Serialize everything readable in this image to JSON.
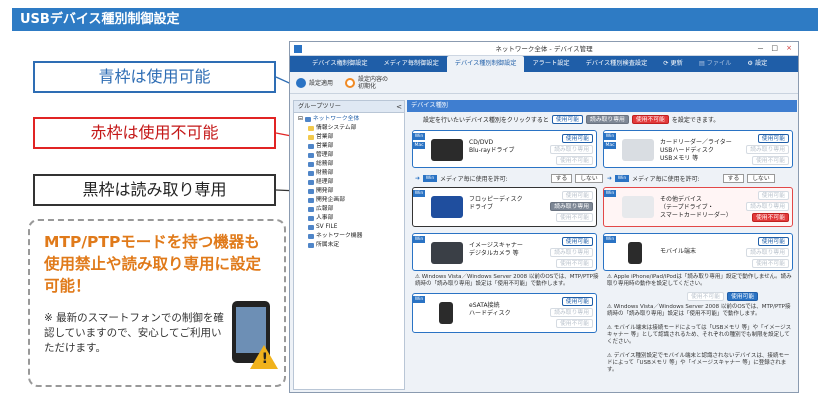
{
  "page_title": "USBデバイス種別制御設定",
  "callouts": {
    "blue": "青枠は使用可能",
    "red": "赤枠は使用不可能",
    "black": "黒枠は読み取り専用"
  },
  "note": {
    "main": "MTP/PTPモードを持つ機器も使用禁止や読み取り専用に設定可能！",
    "sub": "※ 最新のスマートフォンでの制御を確認していますので、安心してご利用いただけます。"
  },
  "app": {
    "window_title": "ネットワーク全体 - デバイス管理",
    "window_buttons": [
      "－",
      "□",
      "×"
    ],
    "tabs": [
      "デバイス権制御設定",
      "メディア毎制御設定",
      "デバイス種別制御設定",
      "アラート設定",
      "デバイス種別検査設定",
      "更新",
      "ファイル",
      "設定"
    ],
    "toolbar": {
      "apply": "設定適用",
      "restore": "設定内容の\n初期化"
    },
    "sidebar": {
      "title": "グループツリー",
      "collapse": "<",
      "items": [
        "ネットワーク全体",
        "情報システム部",
        "営業部",
        "営業部",
        "管理部",
        "総務部",
        "財務部",
        "経理部",
        "開発部",
        "開発企画部",
        "広報部",
        "人事部",
        "SV FILE",
        "ネットワーク機器",
        "所属未定"
      ]
    },
    "main": {
      "heading": "デバイス種別",
      "instruction_pre": "設定を行いたいデバイス種別をクリックすると",
      "instruction_post": "を設定できます。",
      "pill_usable": "使用可能",
      "pill_readonly": "読み取り専用",
      "pill_unusable": "使用不可能",
      "os_win": "Win",
      "os_mac": "Mac",
      "cards": [
        {
          "label": "CD/DVD\nBlu-rayドライブ",
          "state": "blue",
          "b1": "使用可能",
          "b2": "読み取り専用",
          "b3": "使用不可能"
        },
        {
          "label": "カードリーダー／ライター\nUSBハードディスク\nUSBメモリ 等",
          "state": "blue",
          "b1": "使用可能",
          "b2": "読み取り専用",
          "b3": "使用不可能"
        },
        {
          "label": "フロッピーディスク\nドライブ",
          "state": "black",
          "b1": "使用可能",
          "b2": "読み取り専用",
          "b3": "使用不可能"
        },
        {
          "label": "その他デバイス\n（テープドライブ・\nスマートカードリーダー）",
          "state": "red",
          "b1": "使用可能",
          "b2": "読み取り専用",
          "b3": "使用不可能"
        },
        {
          "label": "イメージスキャナー\nデジタルカメラ 等",
          "state": "blue",
          "b1": "使用可能",
          "b2": "読み取り専用",
          "b3": "使用不可能"
        },
        {
          "label": "モバイル端末",
          "state": "blue",
          "b1": "使用可能",
          "b2": "読み取り専用",
          "b3": "使用不可能"
        },
        {
          "label": "eSATA接続\nハードディスク",
          "state": "blue",
          "b1": "使用可能",
          "b2": "読み取り専用",
          "b3": "使用不可能"
        }
      ],
      "media_strip": "メディア毎に使用を許可:",
      "strip_do": "する",
      "strip_dont": "しない",
      "notes": [
        "Windows Vista／Windows Server 2008 以前のOSでは、MTP/PTP接続時の「読み取り専用」設定は「使用不可能」で動作します。",
        "Apple iPhone/iPad/iPodは「読み取り専用」設定で動作しません。読み取り専用時の動作を設定してください。",
        "Windows Vista／Windows Server 2008 以前のOSでは、MTP/PTP接続時の「読み取り専用」設定は「使用不可能」で動作します。",
        "モバイル端末は接続モードによっては「USBメモリ 等」や「イメージスキャナー 等」として認識されるため、それぞれの種別でも制限を設定してください。",
        "デバイス種別設定でモバイル端末と認識されないデバイスは、接続モードによって「USBメモリ 等」や「イメージスキャナー 等」に登録されます。"
      ],
      "bottom_pills": [
        "使用不可能",
        "使用可能"
      ]
    }
  },
  "colors": {
    "title_blue": "#2e7bc4",
    "blue": "#2e6db4",
    "red": "#e12424",
    "black": "#333333",
    "accent_orange": "#e07a1a"
  }
}
